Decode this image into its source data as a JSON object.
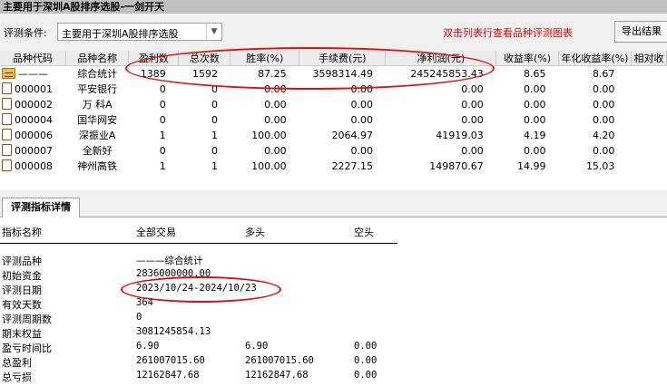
{
  "window": {
    "title": "主要用于深圳A股排序选股-一剑开天"
  },
  "toolbar": {
    "label": "评测条件:",
    "condition_value": "主要用于深圳A股排序选股",
    "hint": "双击列表行查看品种评测图表",
    "export_label": "导出结果"
  },
  "grid": {
    "columns": [
      "品种代码",
      "品种名称",
      "盈利数",
      "总次数",
      "胜率(%)",
      "手续费(元)",
      "净利润(元)",
      "收益率(%)",
      "年化收益率(%)",
      "相对收"
    ],
    "rows": [
      [
        "———",
        "综合统计",
        "1389",
        "1592",
        "87.25",
        "3598314.49",
        "245245853.43",
        "8.65",
        "8.67"
      ],
      [
        "000001",
        "平安银行",
        "0",
        "0",
        "0.00",
        "0.00",
        "0.00",
        "0.00",
        "0.00"
      ],
      [
        "000002",
        "万 科A",
        "0",
        "0",
        "0.00",
        "0.00",
        "0.00",
        "0.00",
        "0.00"
      ],
      [
        "000004",
        "国华网安",
        "0",
        "0",
        "0.00",
        "0.00",
        "0.00",
        "0.00",
        "0.00"
      ],
      [
        "000006",
        "深振业A",
        "1",
        "1",
        "100.00",
        "2064.97",
        "41919.03",
        "4.19",
        "4.20"
      ],
      [
        "000007",
        "全新好",
        "0",
        "0",
        "0.00",
        "0.00",
        "0.00",
        "0.00",
        "0.00"
      ],
      [
        "000008",
        "神州高铁",
        "1",
        "1",
        "100.00",
        "2227.15",
        "149870.67",
        "14.99",
        "15.03"
      ]
    ]
  },
  "detail": {
    "tab_label": "评测指标详情",
    "headers": [
      "指标名称",
      "全部交易",
      "多头",
      "空头"
    ],
    "rows": [
      [
        "评测品种",
        "———综合统计",
        "",
        ""
      ],
      [
        "初始资金",
        "2836000000.00",
        "",
        ""
      ],
      [
        "评测日期",
        "2023/10/24-2024/10/23",
        "",
        ""
      ],
      [
        "有效天数",
        "364",
        "",
        ""
      ],
      [
        "评测周期数",
        "0",
        "",
        ""
      ],
      [
        "期末权益",
        "3081245854.13",
        "",
        ""
      ],
      [
        "盈亏时间比",
        "6.90",
        "6.90",
        "0.00"
      ],
      [
        "总盈利",
        "261007015.60",
        "261007015.60",
        "0.00"
      ],
      [
        "总亏损",
        "12162847.68",
        "12162847.68",
        "0.00"
      ]
    ]
  },
  "colors": {
    "annotation": "#e01010",
    "hint": "#e00000"
  }
}
